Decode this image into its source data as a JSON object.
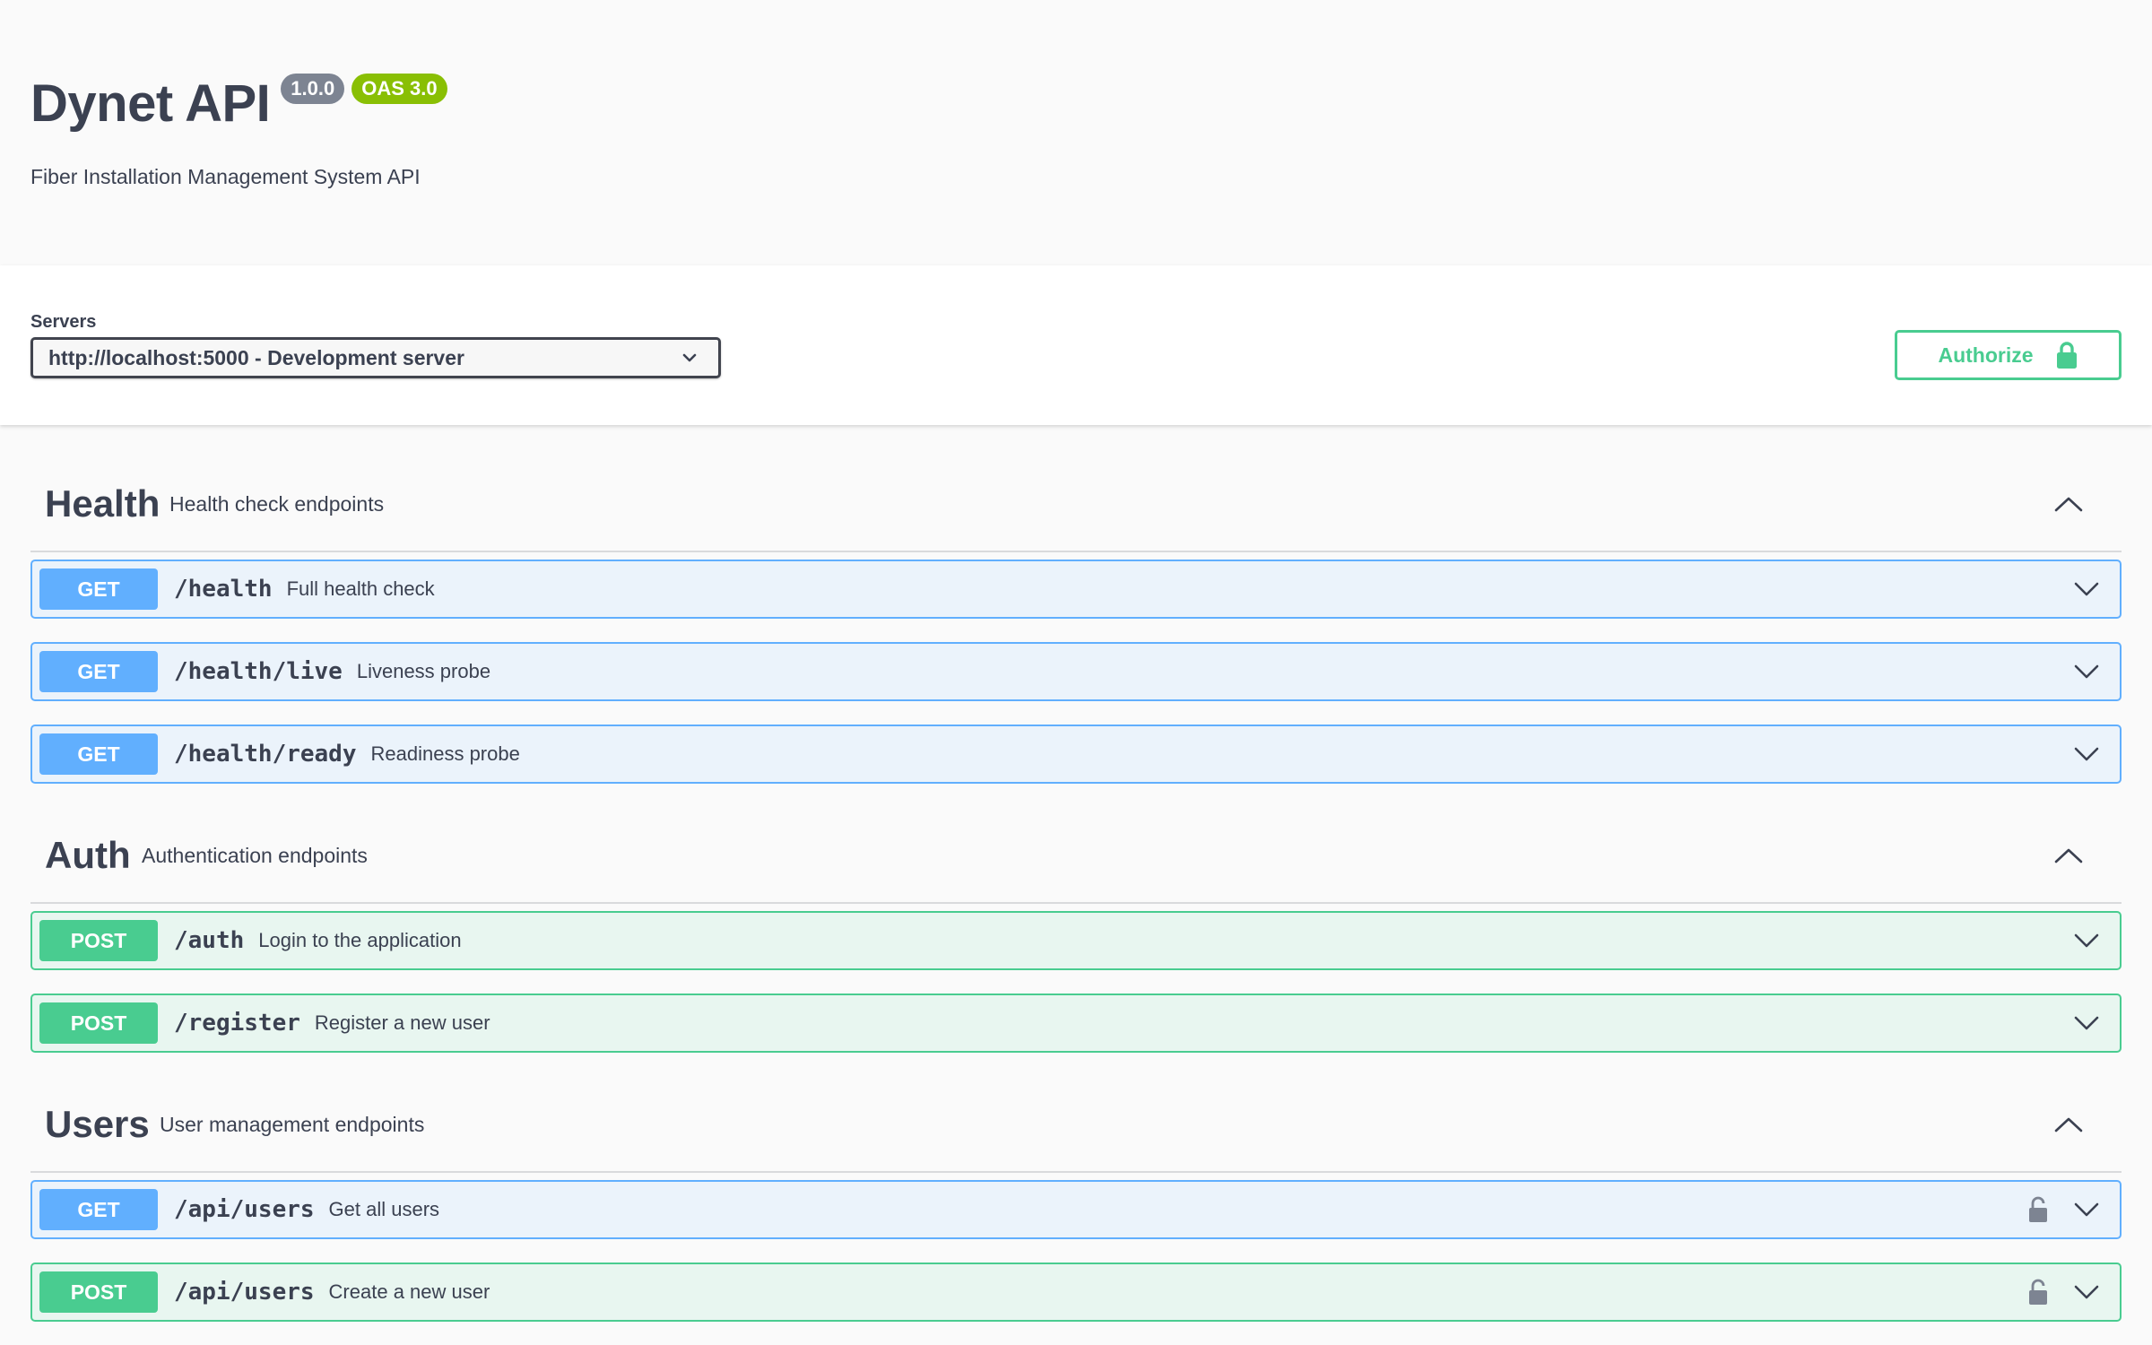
{
  "info": {
    "title": "Dynet API",
    "version": "1.0.0",
    "oas": "OAS 3.0",
    "description": "Fiber Installation Management System API"
  },
  "servers": {
    "label": "Servers",
    "selected": "http://localhost:5000 - Development server"
  },
  "authorize": {
    "label": "Authorize",
    "icon": "lock-icon"
  },
  "colors": {
    "get": "#61affe",
    "post": "#49cc90",
    "text": "#3b4151"
  },
  "tags": [
    {
      "name": "Health",
      "description": "Health check endpoints",
      "operations": [
        {
          "method": "GET",
          "path": "/health",
          "summary": "Full health check"
        },
        {
          "method": "GET",
          "path": "/health/live",
          "summary": "Liveness probe"
        },
        {
          "method": "GET",
          "path": "/health/ready",
          "summary": "Readiness probe"
        }
      ]
    },
    {
      "name": "Auth",
      "description": "Authentication endpoints",
      "operations": [
        {
          "method": "POST",
          "path": "/auth",
          "summary": "Login to the application"
        },
        {
          "method": "POST",
          "path": "/register",
          "summary": "Register a new user"
        }
      ]
    },
    {
      "name": "Users",
      "description": "User management endpoints",
      "operations": [
        {
          "method": "GET",
          "path": "/api/users",
          "summary": "Get all users"
        },
        {
          "method": "POST",
          "path": "/api/users",
          "summary": "Create a new user"
        }
      ]
    }
  ]
}
